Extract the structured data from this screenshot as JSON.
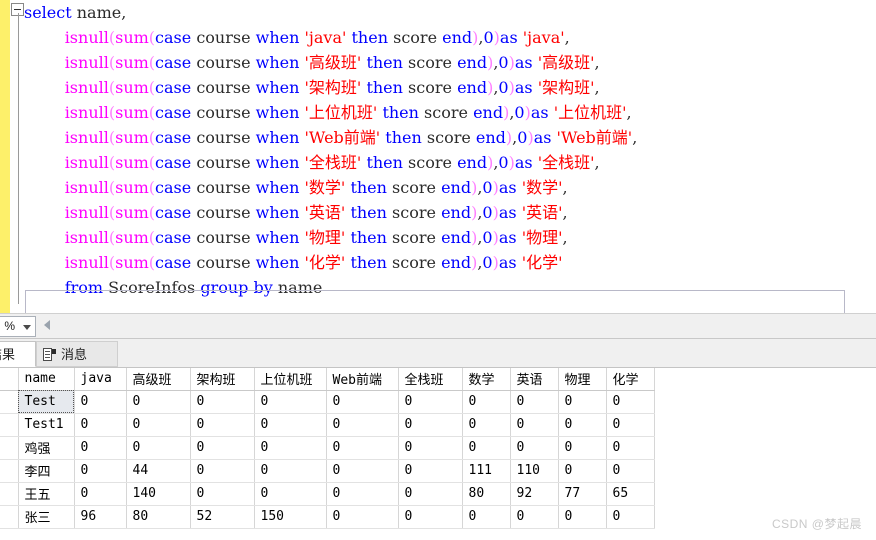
{
  "editor": {
    "collapse_icon": "collapse-minus-icon",
    "lines": [
      [
        {
          "t": "select",
          "c": "kw"
        },
        {
          "t": " ",
          "c": "plain"
        },
        {
          "t": "name",
          "c": "plain"
        },
        {
          "t": ",",
          "c": "plain"
        }
      ],
      [
        {
          "t": "        ",
          "c": "plain"
        },
        {
          "t": "isnull",
          "c": "fn"
        },
        {
          "t": "(",
          "c": "pn"
        },
        {
          "t": "sum",
          "c": "fn"
        },
        {
          "t": "(",
          "c": "pn"
        },
        {
          "t": "case",
          "c": "kw"
        },
        {
          "t": " ",
          "c": "plain"
        },
        {
          "t": "course",
          "c": "plain"
        },
        {
          "t": " ",
          "c": "plain"
        },
        {
          "t": "when",
          "c": "kw"
        },
        {
          "t": " ",
          "c": "plain"
        },
        {
          "t": "'java'",
          "c": "str"
        },
        {
          "t": " ",
          "c": "plain"
        },
        {
          "t": "then",
          "c": "kw"
        },
        {
          "t": " ",
          "c": "plain"
        },
        {
          "t": "score",
          "c": "plain"
        },
        {
          "t": " ",
          "c": "plain"
        },
        {
          "t": "end",
          "c": "kw"
        },
        {
          "t": ")",
          "c": "pn"
        },
        {
          "t": ",",
          "c": "plain"
        },
        {
          "t": "0",
          "c": "num"
        },
        {
          "t": ")",
          "c": "pn"
        },
        {
          "t": "as",
          "c": "kw"
        },
        {
          "t": " ",
          "c": "plain"
        },
        {
          "t": "'java'",
          "c": "str"
        },
        {
          "t": ",",
          "c": "plain"
        }
      ],
      [
        {
          "t": "        ",
          "c": "plain"
        },
        {
          "t": "isnull",
          "c": "fn"
        },
        {
          "t": "(",
          "c": "pn"
        },
        {
          "t": "sum",
          "c": "fn"
        },
        {
          "t": "(",
          "c": "pn"
        },
        {
          "t": "case",
          "c": "kw"
        },
        {
          "t": " ",
          "c": "plain"
        },
        {
          "t": "course",
          "c": "plain"
        },
        {
          "t": " ",
          "c": "plain"
        },
        {
          "t": "when",
          "c": "kw"
        },
        {
          "t": " ",
          "c": "plain"
        },
        {
          "t": "'高级班'",
          "c": "str"
        },
        {
          "t": " ",
          "c": "plain"
        },
        {
          "t": "then",
          "c": "kw"
        },
        {
          "t": " ",
          "c": "plain"
        },
        {
          "t": "score",
          "c": "plain"
        },
        {
          "t": " ",
          "c": "plain"
        },
        {
          "t": "end",
          "c": "kw"
        },
        {
          "t": ")",
          "c": "pn"
        },
        {
          "t": ",",
          "c": "plain"
        },
        {
          "t": "0",
          "c": "num"
        },
        {
          "t": ")",
          "c": "pn"
        },
        {
          "t": "as",
          "c": "kw"
        },
        {
          "t": " ",
          "c": "plain"
        },
        {
          "t": "'高级班'",
          "c": "str"
        },
        {
          "t": ",",
          "c": "plain"
        }
      ],
      [
        {
          "t": "        ",
          "c": "plain"
        },
        {
          "t": "isnull",
          "c": "fn"
        },
        {
          "t": "(",
          "c": "pn"
        },
        {
          "t": "sum",
          "c": "fn"
        },
        {
          "t": "(",
          "c": "pn"
        },
        {
          "t": "case",
          "c": "kw"
        },
        {
          "t": " ",
          "c": "plain"
        },
        {
          "t": "course",
          "c": "plain"
        },
        {
          "t": " ",
          "c": "plain"
        },
        {
          "t": "when",
          "c": "kw"
        },
        {
          "t": " ",
          "c": "plain"
        },
        {
          "t": "'架构班'",
          "c": "str"
        },
        {
          "t": " ",
          "c": "plain"
        },
        {
          "t": "then",
          "c": "kw"
        },
        {
          "t": " ",
          "c": "plain"
        },
        {
          "t": "score",
          "c": "plain"
        },
        {
          "t": " ",
          "c": "plain"
        },
        {
          "t": "end",
          "c": "kw"
        },
        {
          "t": ")",
          "c": "pn"
        },
        {
          "t": ",",
          "c": "plain"
        },
        {
          "t": "0",
          "c": "num"
        },
        {
          "t": ")",
          "c": "pn"
        },
        {
          "t": "as",
          "c": "kw"
        },
        {
          "t": " ",
          "c": "plain"
        },
        {
          "t": "'架构班'",
          "c": "str"
        },
        {
          "t": ",",
          "c": "plain"
        }
      ],
      [
        {
          "t": "        ",
          "c": "plain"
        },
        {
          "t": "isnull",
          "c": "fn"
        },
        {
          "t": "(",
          "c": "pn"
        },
        {
          "t": "sum",
          "c": "fn"
        },
        {
          "t": "(",
          "c": "pn"
        },
        {
          "t": "case",
          "c": "kw"
        },
        {
          "t": " ",
          "c": "plain"
        },
        {
          "t": "course",
          "c": "plain"
        },
        {
          "t": " ",
          "c": "plain"
        },
        {
          "t": "when",
          "c": "kw"
        },
        {
          "t": " ",
          "c": "plain"
        },
        {
          "t": "'上位机班'",
          "c": "str"
        },
        {
          "t": " ",
          "c": "plain"
        },
        {
          "t": "then",
          "c": "kw"
        },
        {
          "t": " ",
          "c": "plain"
        },
        {
          "t": "score",
          "c": "plain"
        },
        {
          "t": " ",
          "c": "plain"
        },
        {
          "t": "end",
          "c": "kw"
        },
        {
          "t": ")",
          "c": "pn"
        },
        {
          "t": ",",
          "c": "plain"
        },
        {
          "t": "0",
          "c": "num"
        },
        {
          "t": ")",
          "c": "pn"
        },
        {
          "t": "as",
          "c": "kw"
        },
        {
          "t": " ",
          "c": "plain"
        },
        {
          "t": "'上位机班'",
          "c": "str"
        },
        {
          "t": ",",
          "c": "plain"
        }
      ],
      [
        {
          "t": "        ",
          "c": "plain"
        },
        {
          "t": "isnull",
          "c": "fn"
        },
        {
          "t": "(",
          "c": "pn"
        },
        {
          "t": "sum",
          "c": "fn"
        },
        {
          "t": "(",
          "c": "pn"
        },
        {
          "t": "case",
          "c": "kw"
        },
        {
          "t": " ",
          "c": "plain"
        },
        {
          "t": "course",
          "c": "plain"
        },
        {
          "t": " ",
          "c": "plain"
        },
        {
          "t": "when",
          "c": "kw"
        },
        {
          "t": " ",
          "c": "plain"
        },
        {
          "t": "'Web前端'",
          "c": "str"
        },
        {
          "t": " ",
          "c": "plain"
        },
        {
          "t": "then",
          "c": "kw"
        },
        {
          "t": " ",
          "c": "plain"
        },
        {
          "t": "score",
          "c": "plain"
        },
        {
          "t": " ",
          "c": "plain"
        },
        {
          "t": "end",
          "c": "kw"
        },
        {
          "t": ")",
          "c": "pn"
        },
        {
          "t": ",",
          "c": "plain"
        },
        {
          "t": "0",
          "c": "num"
        },
        {
          "t": ")",
          "c": "pn"
        },
        {
          "t": "as",
          "c": "kw"
        },
        {
          "t": " ",
          "c": "plain"
        },
        {
          "t": "'Web前端'",
          "c": "str"
        },
        {
          "t": ",",
          "c": "plain"
        }
      ],
      [
        {
          "t": "        ",
          "c": "plain"
        },
        {
          "t": "isnull",
          "c": "fn"
        },
        {
          "t": "(",
          "c": "pn"
        },
        {
          "t": "sum",
          "c": "fn"
        },
        {
          "t": "(",
          "c": "pn"
        },
        {
          "t": "case",
          "c": "kw"
        },
        {
          "t": " ",
          "c": "plain"
        },
        {
          "t": "course",
          "c": "plain"
        },
        {
          "t": " ",
          "c": "plain"
        },
        {
          "t": "when",
          "c": "kw"
        },
        {
          "t": " ",
          "c": "plain"
        },
        {
          "t": "'全栈班'",
          "c": "str"
        },
        {
          "t": " ",
          "c": "plain"
        },
        {
          "t": "then",
          "c": "kw"
        },
        {
          "t": " ",
          "c": "plain"
        },
        {
          "t": "score",
          "c": "plain"
        },
        {
          "t": " ",
          "c": "plain"
        },
        {
          "t": "end",
          "c": "kw"
        },
        {
          "t": ")",
          "c": "pn"
        },
        {
          "t": ",",
          "c": "plain"
        },
        {
          "t": "0",
          "c": "num"
        },
        {
          "t": ")",
          "c": "pn"
        },
        {
          "t": "as",
          "c": "kw"
        },
        {
          "t": " ",
          "c": "plain"
        },
        {
          "t": "'全栈班'",
          "c": "str"
        },
        {
          "t": ",",
          "c": "plain"
        }
      ],
      [
        {
          "t": "        ",
          "c": "plain"
        },
        {
          "t": "isnull",
          "c": "fn"
        },
        {
          "t": "(",
          "c": "pn"
        },
        {
          "t": "sum",
          "c": "fn"
        },
        {
          "t": "(",
          "c": "pn"
        },
        {
          "t": "case",
          "c": "kw"
        },
        {
          "t": " ",
          "c": "plain"
        },
        {
          "t": "course",
          "c": "plain"
        },
        {
          "t": " ",
          "c": "plain"
        },
        {
          "t": "when",
          "c": "kw"
        },
        {
          "t": " ",
          "c": "plain"
        },
        {
          "t": "'数学'",
          "c": "str"
        },
        {
          "t": " ",
          "c": "plain"
        },
        {
          "t": "then",
          "c": "kw"
        },
        {
          "t": " ",
          "c": "plain"
        },
        {
          "t": "score",
          "c": "plain"
        },
        {
          "t": " ",
          "c": "plain"
        },
        {
          "t": "end",
          "c": "kw"
        },
        {
          "t": ")",
          "c": "pn"
        },
        {
          "t": ",",
          "c": "plain"
        },
        {
          "t": "0",
          "c": "num"
        },
        {
          "t": ")",
          "c": "pn"
        },
        {
          "t": "as",
          "c": "kw"
        },
        {
          "t": " ",
          "c": "plain"
        },
        {
          "t": "'数学'",
          "c": "str"
        },
        {
          "t": ",",
          "c": "plain"
        }
      ],
      [
        {
          "t": "        ",
          "c": "plain"
        },
        {
          "t": "isnull",
          "c": "fn"
        },
        {
          "t": "(",
          "c": "pn"
        },
        {
          "t": "sum",
          "c": "fn"
        },
        {
          "t": "(",
          "c": "pn"
        },
        {
          "t": "case",
          "c": "kw"
        },
        {
          "t": " ",
          "c": "plain"
        },
        {
          "t": "course",
          "c": "plain"
        },
        {
          "t": " ",
          "c": "plain"
        },
        {
          "t": "when",
          "c": "kw"
        },
        {
          "t": " ",
          "c": "plain"
        },
        {
          "t": "'英语'",
          "c": "str"
        },
        {
          "t": " ",
          "c": "plain"
        },
        {
          "t": "then",
          "c": "kw"
        },
        {
          "t": " ",
          "c": "plain"
        },
        {
          "t": "score",
          "c": "plain"
        },
        {
          "t": " ",
          "c": "plain"
        },
        {
          "t": "end",
          "c": "kw"
        },
        {
          "t": ")",
          "c": "pn"
        },
        {
          "t": ",",
          "c": "plain"
        },
        {
          "t": "0",
          "c": "num"
        },
        {
          "t": ")",
          "c": "pn"
        },
        {
          "t": "as",
          "c": "kw"
        },
        {
          "t": " ",
          "c": "plain"
        },
        {
          "t": "'英语'",
          "c": "str"
        },
        {
          "t": ",",
          "c": "plain"
        }
      ],
      [
        {
          "t": "        ",
          "c": "plain"
        },
        {
          "t": "isnull",
          "c": "fn"
        },
        {
          "t": "(",
          "c": "pn"
        },
        {
          "t": "sum",
          "c": "fn"
        },
        {
          "t": "(",
          "c": "pn"
        },
        {
          "t": "case",
          "c": "kw"
        },
        {
          "t": " ",
          "c": "plain"
        },
        {
          "t": "course",
          "c": "plain"
        },
        {
          "t": " ",
          "c": "plain"
        },
        {
          "t": "when",
          "c": "kw"
        },
        {
          "t": " ",
          "c": "plain"
        },
        {
          "t": "'物理'",
          "c": "str"
        },
        {
          "t": " ",
          "c": "plain"
        },
        {
          "t": "then",
          "c": "kw"
        },
        {
          "t": " ",
          "c": "plain"
        },
        {
          "t": "score",
          "c": "plain"
        },
        {
          "t": " ",
          "c": "plain"
        },
        {
          "t": "end",
          "c": "kw"
        },
        {
          "t": ")",
          "c": "pn"
        },
        {
          "t": ",",
          "c": "plain"
        },
        {
          "t": "0",
          "c": "num"
        },
        {
          "t": ")",
          "c": "pn"
        },
        {
          "t": "as",
          "c": "kw"
        },
        {
          "t": " ",
          "c": "plain"
        },
        {
          "t": "'物理'",
          "c": "str"
        },
        {
          "t": ",",
          "c": "plain"
        }
      ],
      [
        {
          "t": "        ",
          "c": "plain"
        },
        {
          "t": "isnull",
          "c": "fn"
        },
        {
          "t": "(",
          "c": "pn"
        },
        {
          "t": "sum",
          "c": "fn"
        },
        {
          "t": "(",
          "c": "pn"
        },
        {
          "t": "case",
          "c": "kw"
        },
        {
          "t": " ",
          "c": "plain"
        },
        {
          "t": "course",
          "c": "plain"
        },
        {
          "t": " ",
          "c": "plain"
        },
        {
          "t": "when",
          "c": "kw"
        },
        {
          "t": " ",
          "c": "plain"
        },
        {
          "t": "'化学'",
          "c": "str"
        },
        {
          "t": " ",
          "c": "plain"
        },
        {
          "t": "then",
          "c": "kw"
        },
        {
          "t": " ",
          "c": "plain"
        },
        {
          "t": "score",
          "c": "plain"
        },
        {
          "t": " ",
          "c": "plain"
        },
        {
          "t": "end",
          "c": "kw"
        },
        {
          "t": ")",
          "c": "pn"
        },
        {
          "t": ",",
          "c": "plain"
        },
        {
          "t": "0",
          "c": "num"
        },
        {
          "t": ")",
          "c": "pn"
        },
        {
          "t": "as",
          "c": "kw"
        },
        {
          "t": " ",
          "c": "plain"
        },
        {
          "t": "'化学'",
          "c": "str"
        }
      ],
      [
        {
          "t": "        ",
          "c": "plain"
        },
        {
          "t": "from",
          "c": "kw"
        },
        {
          "t": " ",
          "c": "plain"
        },
        {
          "t": "ScoreInfos",
          "c": "plain"
        },
        {
          "t": " ",
          "c": "plain"
        },
        {
          "t": "group",
          "c": "kw"
        },
        {
          "t": " ",
          "c": "plain"
        },
        {
          "t": "by",
          "c": "kw"
        },
        {
          "t": " ",
          "c": "plain"
        },
        {
          "t": "name",
          "c": "plain"
        }
      ]
    ]
  },
  "zoom_bar": {
    "zoom_value": "%",
    "dropdown_icon": "chevron-down-icon",
    "scroll_left_icon": "scroll-left-arrow-icon"
  },
  "result_tabs": [
    {
      "label": "结果",
      "icon": "grid-icon",
      "active": true
    },
    {
      "label": "消息",
      "icon": "message-sheet-icon",
      "active": false
    }
  ],
  "grid": {
    "columns": [
      "name",
      "java",
      "高级班",
      "架构班",
      "上位机班",
      "Web前端",
      "全栈班",
      "数学",
      "英语",
      "物理",
      "化学"
    ],
    "rows": [
      [
        "Test",
        "0",
        "0",
        "0",
        "0",
        "0",
        "0",
        "0",
        "0",
        "0",
        "0"
      ],
      [
        "Test1",
        "0",
        "0",
        "0",
        "0",
        "0",
        "0",
        "0",
        "0",
        "0",
        "0"
      ],
      [
        "鸡强",
        "0",
        "0",
        "0",
        "0",
        "0",
        "0",
        "0",
        "0",
        "0",
        "0"
      ],
      [
        "李四",
        "0",
        "44",
        "0",
        "0",
        "0",
        "0",
        "111",
        "110",
        "0",
        "0"
      ],
      [
        "王五",
        "0",
        "140",
        "0",
        "0",
        "0",
        "0",
        "80",
        "92",
        "77",
        "65"
      ],
      [
        "张三",
        "96",
        "80",
        "52",
        "150",
        "0",
        "0",
        "0",
        "0",
        "0",
        "0"
      ]
    ],
    "selected_cell": {
      "row": 0,
      "col": 0
    }
  },
  "watermark": "CSDN @梦起晨",
  "colors": {
    "keyword": "#0000ff",
    "function": "#ff00ff",
    "string": "#ff0000",
    "change_bar": "#fdf06a",
    "selection": "#e6e9ee"
  }
}
